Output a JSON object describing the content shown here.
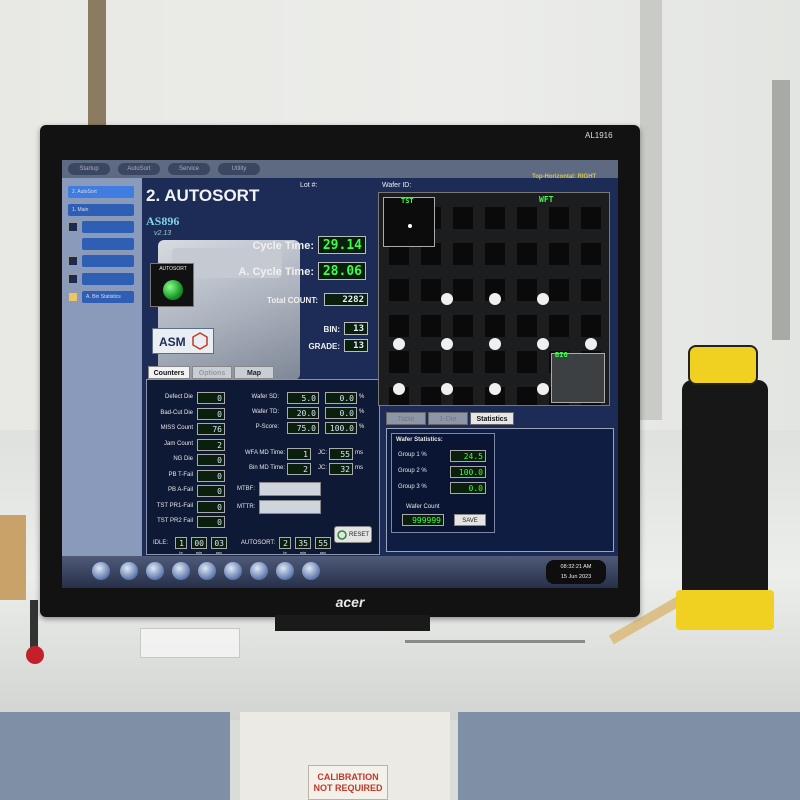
{
  "monitor": {
    "brand": "acer",
    "model_label": "AL1916"
  },
  "top_tabs": [
    "Startup",
    "AutoSort",
    "Service",
    "Utility"
  ],
  "sidebar": {
    "items": [
      {
        "label": "2. AutoSort",
        "checkbox": false
      },
      {
        "label": "1. Main",
        "checkbox": false
      },
      {
        "label": "",
        "checkbox": true
      },
      {
        "label": "",
        "checkbox": true
      },
      {
        "label": "",
        "checkbox": true
      },
      {
        "label": "",
        "checkbox": true
      },
      {
        "label": "A. Bin Statistics",
        "checkbox": true
      }
    ]
  },
  "header": {
    "title": "2. AUTOSORT",
    "lot_label": "Lot #:",
    "wafer_id_label": "Wafer ID:",
    "orientation": "Top-Horizontal: RIGHT"
  },
  "machine": {
    "model": "AS896",
    "version": "v2.13",
    "autosort_label": "AUTOSORT",
    "logo_text": "ASM"
  },
  "cycle": {
    "cycle_time_label": "Cycle Time:",
    "cycle_time": "29.14",
    "avg_cycle_time_label": "A. Cycle Time:",
    "avg_cycle_time": "28.06",
    "total_count_label": "Total COUNT:",
    "total_count": "2282",
    "bin_label": "BIN:",
    "bin": "13",
    "grade_label": "GRADE:",
    "grade": "13"
  },
  "counter_tabs": [
    "Counters",
    "Options",
    "Map"
  ],
  "counters": [
    {
      "label": "Defect Die",
      "value": "0"
    },
    {
      "label": "Bad-Cut Die",
      "value": "0"
    },
    {
      "label": "MISS Count",
      "value": "76"
    },
    {
      "label": "Jam Count",
      "value": "2"
    },
    {
      "label": "NG Die",
      "value": "0"
    },
    {
      "label": "PB T-Fail",
      "value": "0"
    },
    {
      "label": "PB A-Fail",
      "value": "0"
    },
    {
      "label": "TST PR1-Fail",
      "value": "0"
    },
    {
      "label": "TST PR2 Fail",
      "value": "0"
    }
  ],
  "wafer_params": [
    {
      "label": "Wafer SD:",
      "value": "5.0",
      "value2": "0.0",
      "unit": "%"
    },
    {
      "label": "Wafer TD:",
      "value": "20.0",
      "value2": "0.0",
      "unit": "%"
    },
    {
      "label": "P-Score:",
      "value": "75.0",
      "value2": "100.0",
      "unit": "%"
    }
  ],
  "md_times": [
    {
      "label": "WFA MD Time:",
      "value": "1",
      "jc_label": "JC:",
      "jc": "55",
      "unit": "ms"
    },
    {
      "label": "Bin MD Time:",
      "value": "2",
      "jc_label": "JC:",
      "jc": "32",
      "unit": "ms"
    }
  ],
  "mtbf_label": "MTBF:",
  "mttr_label": "MTTR:",
  "idle": {
    "label": "IDLE:",
    "h": "1",
    "m": "00",
    "s": "03",
    "units": [
      "hr",
      "min",
      "sec"
    ]
  },
  "autosort_time": {
    "label": "AUTOSORT:",
    "h": "2",
    "m": "35",
    "s": "55",
    "units": [
      "hr",
      "min",
      "sec"
    ]
  },
  "reset_label": "RESET",
  "wafer_map": {
    "tst_label": "TST",
    "wft_label": "WFT",
    "big_label": "BIG"
  },
  "right_tabs": [
    "Table",
    "1-Die",
    "Statistics"
  ],
  "wafer_statistics": {
    "title": "Wafer Statistics:",
    "groups": [
      {
        "label": "Group 1 %",
        "value": "24.5"
      },
      {
        "label": "Group 2 %",
        "value": "100.0"
      },
      {
        "label": "Group 3 %",
        "value": "0.0"
      }
    ],
    "wafer_count_label": "Wafer Count",
    "wafer_count": "999999",
    "save_label": "SAVE"
  },
  "clock": {
    "time": "08:32:21 AM",
    "date": "15 Jun 2023"
  },
  "bench": {
    "calibration_sticker": "CALIBRATION NOT REQUIRED"
  },
  "colors": {
    "lcd_green": "#3bff4a",
    "screen_bg": "#1d2c56",
    "flashlight_yellow": "#f0d020"
  }
}
